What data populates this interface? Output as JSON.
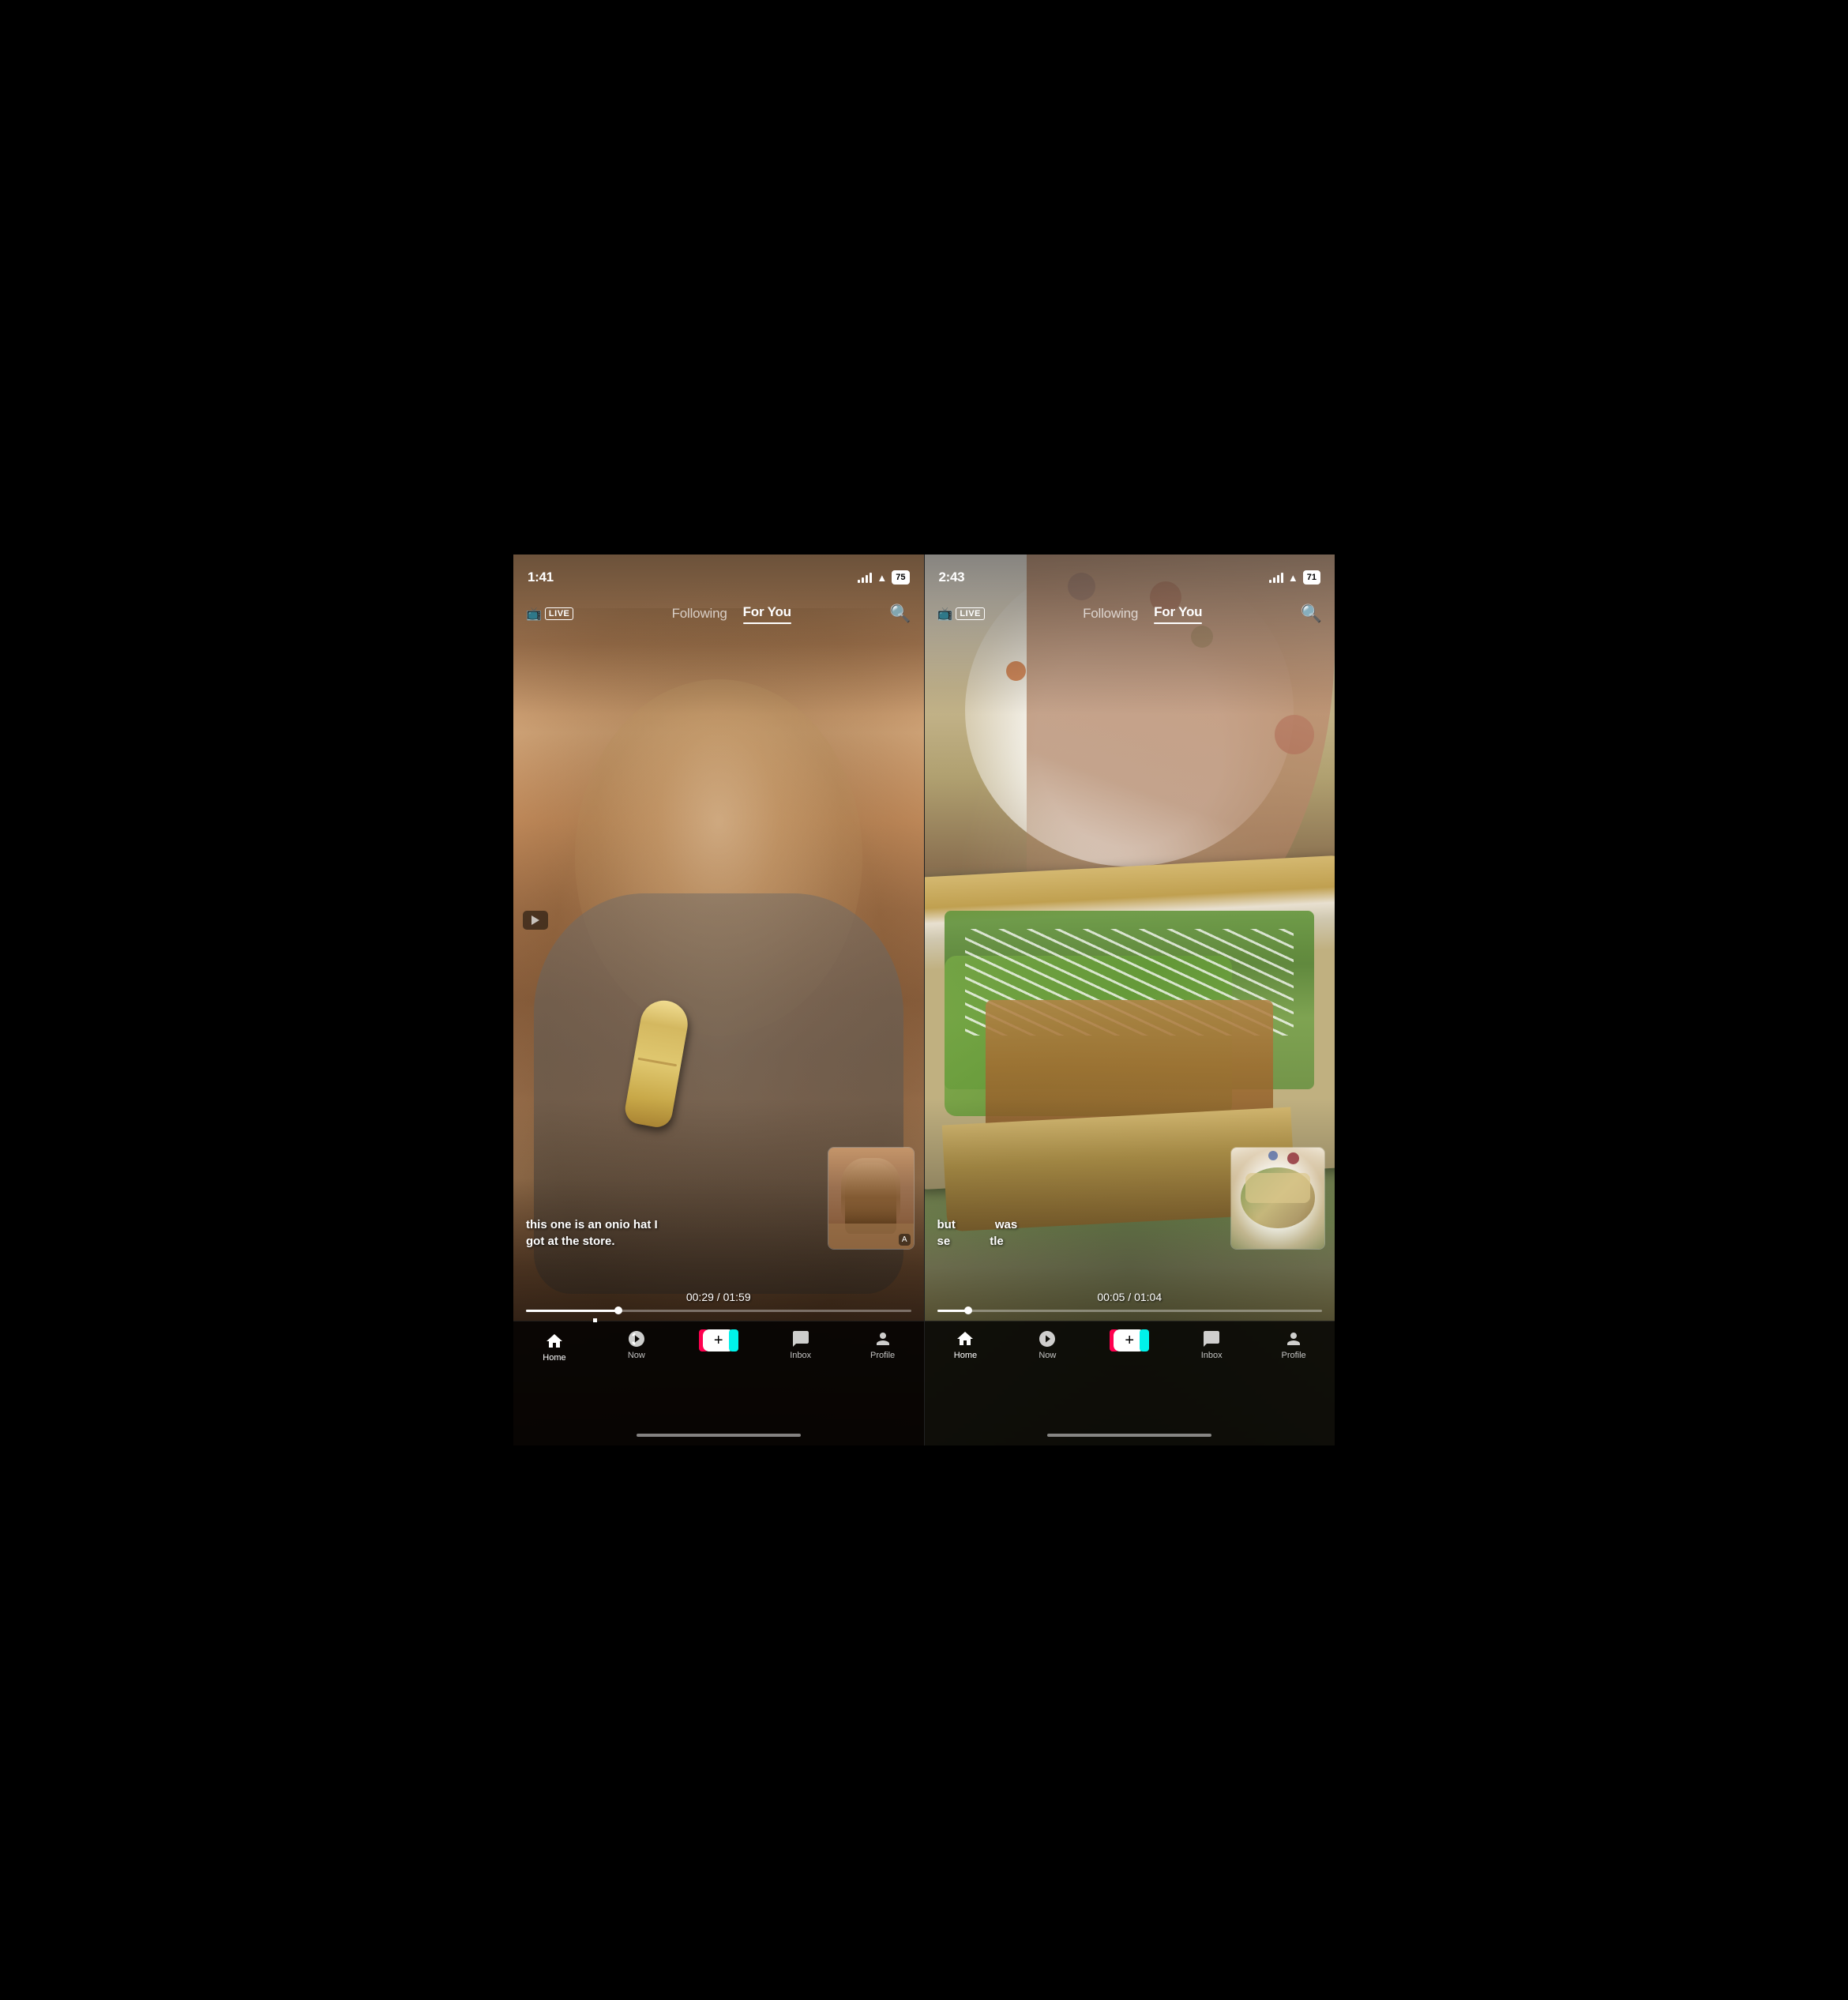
{
  "phones": [
    {
      "id": "left",
      "statusBar": {
        "time": "1:41",
        "battery": "75",
        "showBattery": true
      },
      "navHeader": {
        "liveLabel": "LIVE",
        "followingLabel": "Following",
        "forYouLabel": "For You",
        "activeTab": "For You"
      },
      "captions": {
        "line1": "this one is an onio",
        "line2": "got at the store.",
        "suffix": "hat I"
      },
      "progress": {
        "current": "00:29",
        "total": "01:59",
        "percent": 24
      },
      "bottomNav": {
        "items": [
          {
            "id": "home",
            "label": "Home",
            "icon": "🏠",
            "active": true
          },
          {
            "id": "now",
            "label": "Now",
            "icon": "⚡",
            "active": false
          },
          {
            "id": "plus",
            "label": "",
            "icon": "+",
            "active": false
          },
          {
            "id": "inbox",
            "label": "Inbox",
            "icon": "💬",
            "active": false
          },
          {
            "id": "profile",
            "label": "Profile",
            "icon": "👤",
            "active": false
          }
        ]
      }
    },
    {
      "id": "right",
      "statusBar": {
        "time": "2:43",
        "battery": "71",
        "showBattery": true
      },
      "navHeader": {
        "liveLabel": "LIVE",
        "followingLabel": "Following",
        "forYouLabel": "For You",
        "activeTab": "For You"
      },
      "captions": {
        "line1": "but",
        "line2": "se",
        "suffix1": "was",
        "suffix2": "tle"
      },
      "progress": {
        "current": "00:05",
        "total": "01:04",
        "percent": 8
      },
      "bottomNav": {
        "items": [
          {
            "id": "home",
            "label": "Home",
            "icon": "🏠",
            "active": true
          },
          {
            "id": "now",
            "label": "Now",
            "icon": "⚡",
            "active": false
          },
          {
            "id": "plus",
            "label": "",
            "icon": "+",
            "active": false
          },
          {
            "id": "inbox",
            "label": "Inbox",
            "icon": "💬",
            "active": false
          },
          {
            "id": "profile",
            "label": "Profile",
            "icon": "👤",
            "active": false
          }
        ]
      }
    }
  ]
}
